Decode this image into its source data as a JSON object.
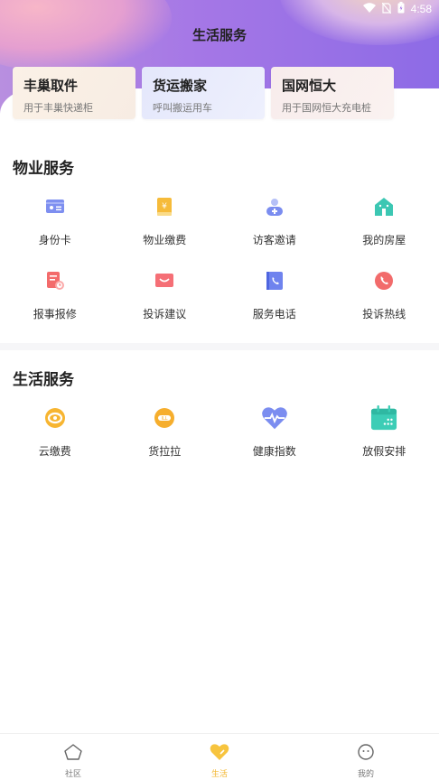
{
  "status_bar": {
    "time": "4:58"
  },
  "header": {
    "title": "生活服务"
  },
  "top_cards": [
    {
      "title": "丰巢取件",
      "subtitle": "用于丰巢快递柜"
    },
    {
      "title": "货运搬家",
      "subtitle": "呼叫搬运用车"
    },
    {
      "title": "国网恒大",
      "subtitle": "用于国网恒大充电桩"
    }
  ],
  "property_services": {
    "title": "物业服务",
    "items": [
      {
        "label": "身份卡",
        "icon": "id-card-icon"
      },
      {
        "label": "物业缴费",
        "icon": "payment-card-icon"
      },
      {
        "label": "访客邀请",
        "icon": "visitor-add-icon"
      },
      {
        "label": "我的房屋",
        "icon": "house-icon"
      },
      {
        "label": "报事报修",
        "icon": "repair-report-icon"
      },
      {
        "label": "投诉建议",
        "icon": "message-icon"
      },
      {
        "label": "服务电话",
        "icon": "phone-book-icon"
      },
      {
        "label": "投诉热线",
        "icon": "hotline-icon"
      }
    ]
  },
  "life_services": {
    "title": "生活服务",
    "items": [
      {
        "label": "云缴费",
        "icon": "cloud-pay-icon"
      },
      {
        "label": "货拉拉",
        "icon": "huolala-icon"
      },
      {
        "label": "健康指数",
        "icon": "heart-pulse-icon"
      },
      {
        "label": "放假安排",
        "icon": "calendar-icon"
      }
    ]
  },
  "bottom_nav": [
    {
      "label": "社区",
      "icon": "community-icon",
      "active": false
    },
    {
      "label": "生活",
      "icon": "heart-icon",
      "active": true
    },
    {
      "label": "我的",
      "icon": "profile-icon",
      "active": false
    }
  ],
  "colors": {
    "accent": "#f2b52c",
    "header_purple": "#a577e6"
  }
}
